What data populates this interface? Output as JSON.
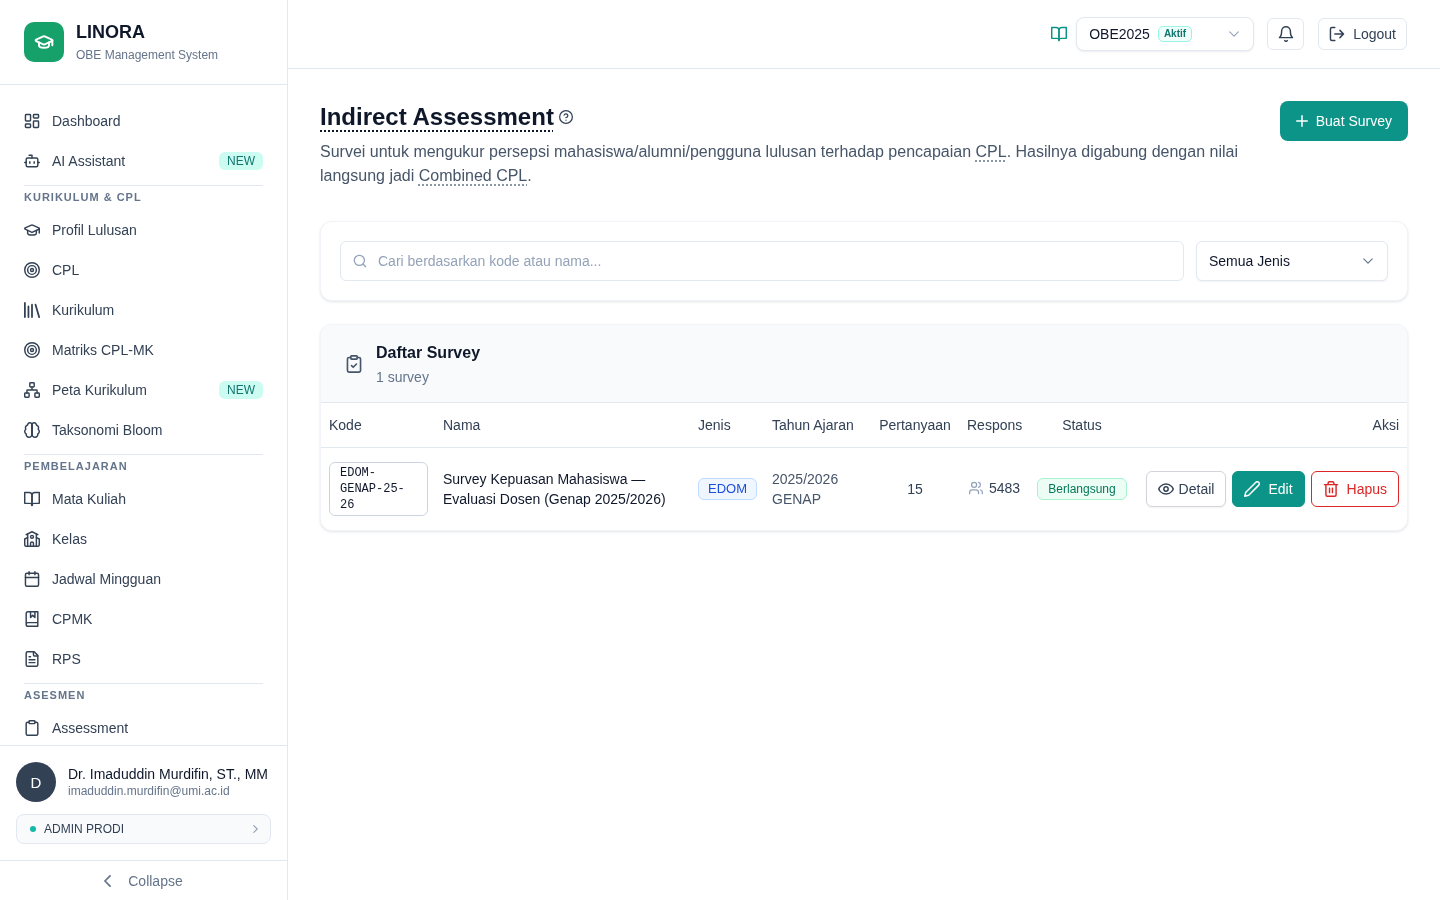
{
  "sidebar": {
    "brand": {
      "name": "LINORA",
      "subtitle": "OBE Management System"
    },
    "nav": [
      {
        "items": [
          {
            "label": "Dashboard",
            "selected": false
          },
          {
            "label": "AI Assistant",
            "badge": "NEW",
            "selected": false
          }
        ]
      },
      {
        "heading": "KURIKULUM & CPL",
        "items": [
          {
            "label": "Profil Lulusan",
            "selected": false
          },
          {
            "label": "CPL",
            "selected": false
          },
          {
            "label": "Kurikulum",
            "selected": false
          },
          {
            "label": "Matriks CPL-MK",
            "selected": false
          },
          {
            "label": "Peta Kurikulum",
            "badge": "NEW",
            "selected": false
          },
          {
            "label": "Taksonomi Bloom",
            "selected": false
          }
        ]
      },
      {
        "heading": "PEMBELAJARAN",
        "items": [
          {
            "label": "Mata Kuliah",
            "selected": false
          },
          {
            "label": "Kelas",
            "selected": false
          },
          {
            "label": "Jadwal Mingguan",
            "selected": false
          },
          {
            "label": "CPMK",
            "selected": false
          },
          {
            "label": "RPS",
            "selected": false
          }
        ]
      },
      {
        "heading": "ASESMEN",
        "items": [
          {
            "label": "Assessment",
            "selected": false
          }
        ]
      }
    ],
    "user": {
      "initial": "D",
      "name": "Dr. Imaduddin Murdifin, ST., MM",
      "email": "imaduddin.murdifin@umi.ac.id",
      "role": "ADMIN PRODI"
    },
    "collapse": "Collapse"
  },
  "topbar": {
    "curriculum": {
      "value": "OBE2025",
      "badge": "Aktif"
    },
    "logout": "Logout"
  },
  "header": {
    "title": "Indirect Assessment",
    "description": [
      {
        "kind": "text",
        "text": "Survei untuk mengukur persepsi mahasiswa/alumni/pengguna lulusan terhadap pencapaian "
      },
      {
        "kind": "term",
        "text": "CPL"
      },
      {
        "kind": "text",
        "text": ". Hasilnya digabung dengan nilai langsung jadi "
      },
      {
        "kind": "term",
        "text": "Combined CPL"
      },
      {
        "kind": "text",
        "text": "."
      }
    ],
    "create_button": "Buat Survey"
  },
  "filters": {
    "search": {
      "placeholder": "Cari berdasarkan kode atau nama..."
    },
    "type": {
      "value": "Semua Jenis"
    }
  },
  "survey_list": {
    "title": "Daftar Survey",
    "count": "1 survey",
    "columns": [
      "Kode",
      "Nama",
      "Jenis",
      "Tahun Ajaran",
      "Pertanyaan",
      "Respons",
      "Status",
      "Aksi"
    ],
    "rows": [
      {
        "code": "EDOM-GENAP-25-26",
        "name": "Survey Kepuasan Mahasiswa — Evaluasi Dosen (Genap 2025/2026)",
        "type": "EDOM",
        "academic_year": "2025/2026",
        "semester": "GENAP",
        "questions": "15",
        "responses": "5483",
        "status": "Berlangsung",
        "actions": [
          {
            "kind": "view",
            "label": "Detail"
          },
          {
            "kind": "edit",
            "label": "Edit"
          },
          {
            "kind": "delete",
            "label": "Hapus"
          }
        ]
      }
    ]
  }
}
